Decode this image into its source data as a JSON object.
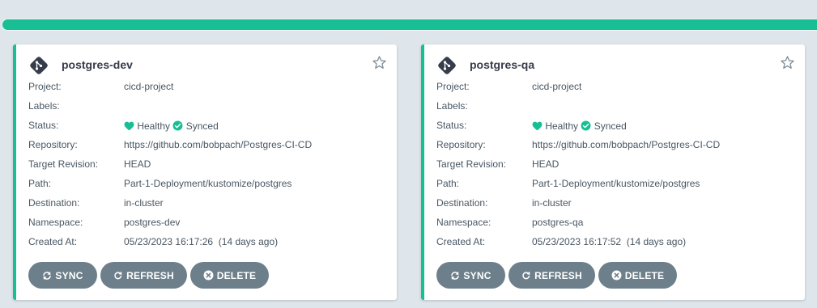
{
  "colors": {
    "healthy": "#18be94",
    "button": "#6d7f8b",
    "background": "#dee6eb"
  },
  "field_labels": {
    "project": "Project:",
    "labels": "Labels:",
    "status": "Status:",
    "repository": "Repository:",
    "target_revision": "Target Revision:",
    "path": "Path:",
    "destination": "Destination:",
    "namespace": "Namespace:",
    "created_at": "Created At:"
  },
  "buttons": {
    "sync": "SYNC",
    "refresh": "REFRESH",
    "delete": "DELETE"
  },
  "apps": [
    {
      "name": "postgres-dev",
      "project": "cicd-project",
      "labels": "",
      "health": "Healthy",
      "sync": "Synced",
      "repository": "https://github.com/bobpach/Postgres-CI-CD",
      "target_revision": "HEAD",
      "path": "Part-1-Deployment/kustomize/postgres",
      "destination": "in-cluster",
      "namespace": "postgres-dev",
      "created_at": "05/23/2023 16:17:26  (14 days ago)"
    },
    {
      "name": "postgres-qa",
      "project": "cicd-project",
      "labels": "",
      "health": "Healthy",
      "sync": "Synced",
      "repository": "https://github.com/bobpach/Postgres-CI-CD",
      "target_revision": "HEAD",
      "path": "Part-1-Deployment/kustomize/postgres",
      "destination": "in-cluster",
      "namespace": "postgres-qa",
      "created_at": "05/23/2023 16:17:52  (14 days ago)"
    }
  ]
}
